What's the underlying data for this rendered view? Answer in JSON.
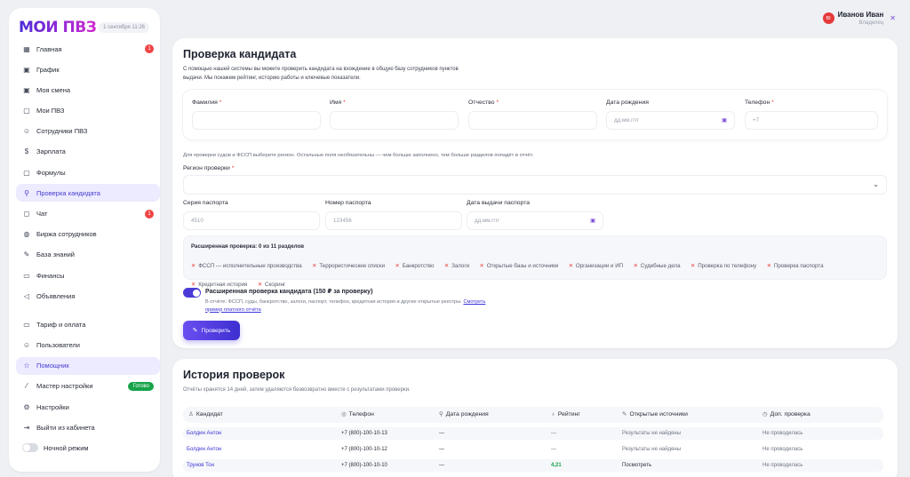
{
  "brand": {
    "logo": "МОИ ПВЗ",
    "date": "1 сентября 11:26"
  },
  "sidebar": {
    "items": [
      {
        "label": "Главная",
        "icon": "grid-icon",
        "badge": "1"
      },
      {
        "label": "График",
        "icon": "calendar-icon"
      },
      {
        "label": "Моя смена",
        "icon": "calendar-icon"
      },
      {
        "label": "Мои ПВЗ",
        "icon": "box-icon"
      },
      {
        "label": "Сотрудники ПВЗ",
        "icon": "users-icon"
      },
      {
        "label": "Зарплата",
        "icon": "dollar-icon"
      },
      {
        "label": "Формулы",
        "icon": "box-icon"
      },
      {
        "label": "Проверка кандидата",
        "icon": "search-user-icon",
        "active": true
      },
      {
        "label": "Чат",
        "icon": "chat-icon",
        "badge": "1"
      },
      {
        "label": "Биржа сотрудников",
        "icon": "globe-icon"
      },
      {
        "label": "База знаний",
        "icon": "pencil-icon"
      },
      {
        "label": "Финансы",
        "icon": "wallet-icon"
      },
      {
        "label": "Объявления",
        "icon": "megaphone-icon"
      }
    ],
    "bottom_items": [
      {
        "label": "Тариф и оплата",
        "icon": "card-icon"
      },
      {
        "label": "Пользователи",
        "icon": "users-icon"
      },
      {
        "label": "Помощник",
        "icon": "star-icon",
        "active": true
      },
      {
        "label": "Мастер настройки",
        "icon": "wand-icon",
        "tag": "Готово"
      },
      {
        "label": "Настройки",
        "icon": "gear-icon"
      },
      {
        "label": "Выйти из кабинета",
        "icon": "logout-icon"
      },
      {
        "label": "Ночной режим",
        "icon": "toggle-icon"
      }
    ]
  },
  "user": {
    "avatar": "ВI",
    "name": "Иванов Иван",
    "role": "Владелец"
  },
  "check": {
    "title": "Проверка кандидата",
    "description": "С помощью нашей системы вы можете проверить кандидата на вхождение в общую базу сотрудников пунктов выдачи. Мы покажем рейтинг, историю работы и ключевые показатели.",
    "fields": {
      "last_name": {
        "label": "Фамилия",
        "placeholder": ""
      },
      "first_name": {
        "label": "Имя",
        "placeholder": ""
      },
      "patronymic": {
        "label": "Отчество",
        "placeholder": ""
      },
      "birth_date": {
        "label": "Дата рождения",
        "placeholder": "дд.мм.гггг"
      },
      "phone": {
        "label": "Телефон",
        "placeholder": "+7"
      }
    },
    "hint": "Для проверки судов и ФССП выберите регион. Остальные поля необязательны — чем больше заполнено, тем больше разделов попадёт в отчёт.",
    "region_label": "Регион проверки",
    "passport": {
      "series": {
        "label": "Серия паспорта",
        "placeholder": "4510"
      },
      "number": {
        "label": "Номер паспорта",
        "placeholder": "123456"
      },
      "issue_date": {
        "label": "Дата выдачи паспорта",
        "placeholder": "дд.мм.гггг"
      }
    },
    "extended": {
      "title": "Расширенная проверка: 0 из 11 разделов",
      "chips": [
        "ФССП — исполнительные производства",
        "Террористические списки",
        "Банкротство",
        "Залоги",
        "Открытые базы и источники",
        "Организации и ИП",
        "Судебные дела",
        "Проверка по телефону",
        "Проверка паспорта",
        "Кредитная история",
        "Скоринг"
      ]
    },
    "toggle": {
      "title": "Расширенная проверка кандидата (150 ₽ за проверку)",
      "description": "В отчёте: ФССП, суды, банкротство, залоги, паспорт, телефон, кредитная история и другие открытые реестры.",
      "link": "Смотреть пример платного отчёта"
    },
    "button": "Проверить"
  },
  "history": {
    "title": "История проверок",
    "description": "Отчёты хранятся 14 дней, затем удаляются безвозвратно вместе с результатами проверки.",
    "columns": [
      "Кандидат",
      "Телефон",
      "Дата рождения",
      "Рейтинг",
      "Открытые источники",
      "Доп. проверка"
    ],
    "rows": [
      {
        "name": "Болдин Антон",
        "phone": "+7 (800)-100-10-13",
        "birth": "—",
        "rating": "—",
        "sources": "Результаты не найдены",
        "extra": "Не проводилась"
      },
      {
        "name": "Болдин Антон",
        "phone": "+7 (800)-100-10-12",
        "birth": "—",
        "rating": "—",
        "sources": "Результаты не найдены",
        "extra": "Не проводилась"
      },
      {
        "name": "Трунов Тон",
        "phone": "+7 (800)-100-10-10",
        "birth": "—",
        "rating": "4,21",
        "sources": "Посмотреть",
        "extra": "Не проводилась"
      }
    ]
  }
}
